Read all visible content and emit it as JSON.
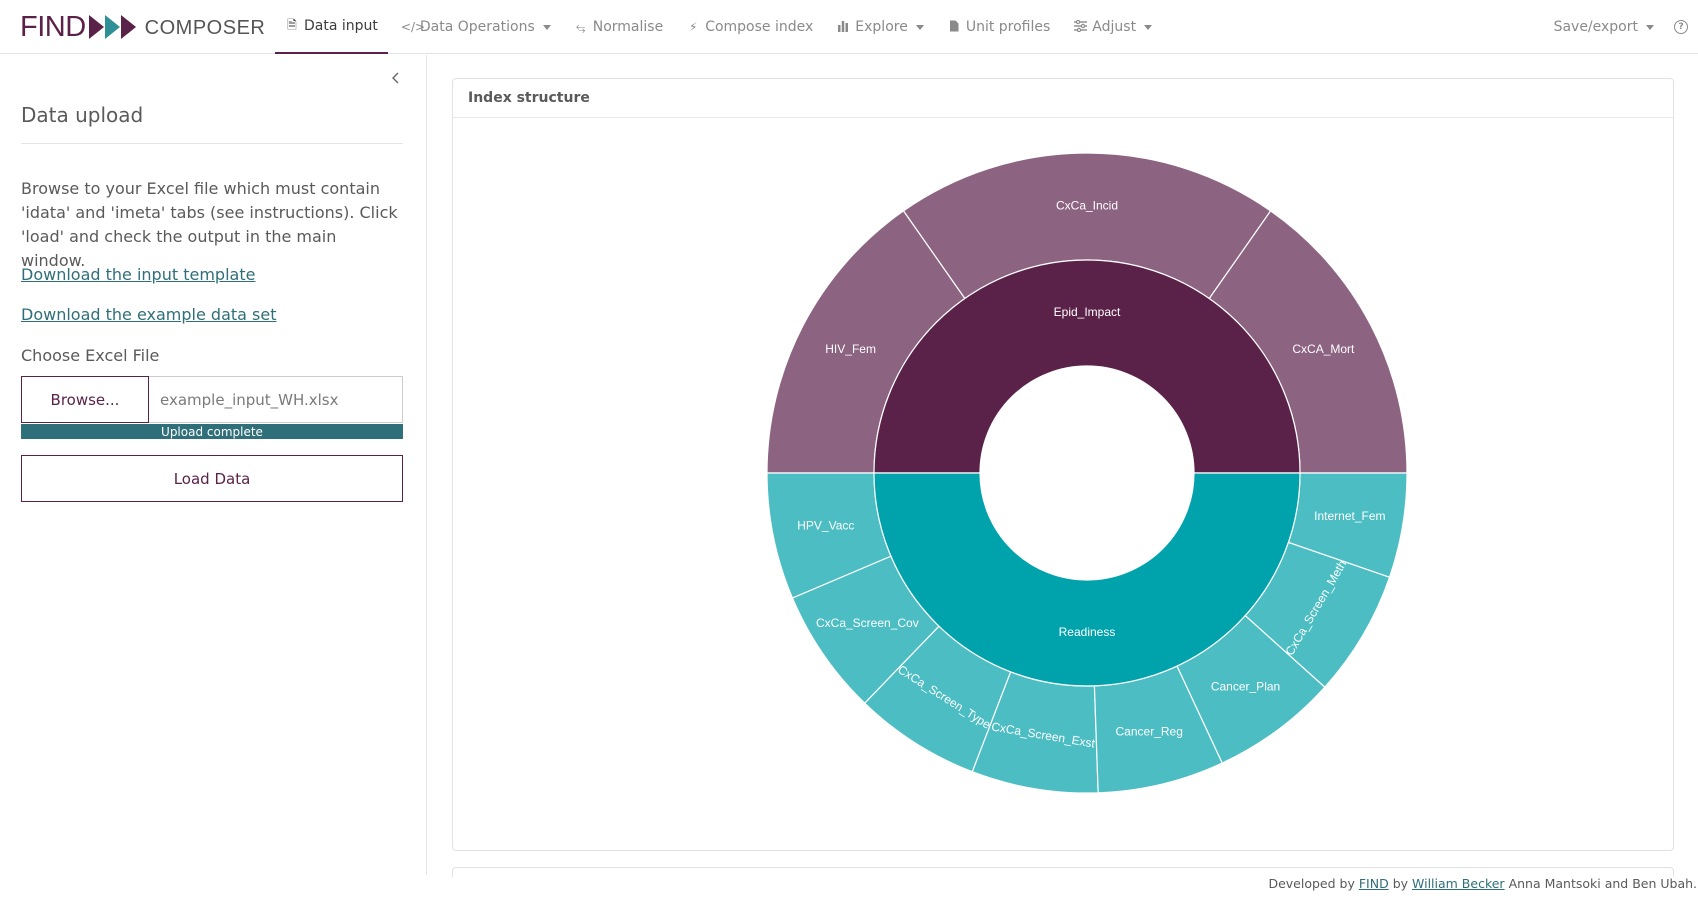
{
  "brand": {
    "find": "FIND",
    "composer": "COMPOSER"
  },
  "nav": {
    "items": [
      {
        "label": "Data input",
        "icon": "file-import-icon",
        "dropdown": false,
        "active": true
      },
      {
        "label": "Data Operations",
        "icon": "code-icon",
        "dropdown": true,
        "active": false
      },
      {
        "label": "Normalise",
        "icon": "compress-icon",
        "dropdown": false,
        "active": false
      },
      {
        "label": "Compose index",
        "icon": "bolt-icon",
        "dropdown": false,
        "active": false
      },
      {
        "label": "Explore",
        "icon": "bar-chart-icon",
        "dropdown": true,
        "active": false
      },
      {
        "label": "Unit profiles",
        "icon": "file-icon",
        "dropdown": false,
        "active": false
      },
      {
        "label": "Adjust",
        "icon": "sliders-icon",
        "dropdown": true,
        "active": false
      }
    ],
    "save_export": "Save/export",
    "help": "?"
  },
  "sidebar": {
    "title": "Data upload",
    "description": "Browse to your Excel file which must contain 'idata' and 'imeta' tabs (see instructions). Click 'load' and check the output in the main window.",
    "link_template": "Download the input template",
    "link_example": "Download the example data set",
    "file_label": "Choose Excel File",
    "browse_label": "Browse...",
    "file_name": "example_input_WH.xlsx",
    "progress_label": "Upload complete",
    "progress_fraction": 1.0,
    "load_label": "Load Data"
  },
  "main": {
    "card_title": "Index structure"
  },
  "chart_data": {
    "type": "sunburst",
    "colors": {
      "Epid_Impact": "#5b2249",
      "Epid_Impact_child": "#8c6380",
      "Readiness": "#00a2ac",
      "Readiness_child": "#4bbdc3"
    },
    "groups": [
      {
        "name": "Epid_Impact",
        "children": [
          "CxCA_Mort",
          "CxCa_Incid",
          "HIV_Fem"
        ]
      },
      {
        "name": "Readiness",
        "children": [
          "HPV_Vacc",
          "CxCa_Screen_Cov",
          "CxCa_Screen_Type",
          "CxCa_Screen_Exst",
          "Cancer_Reg",
          "Cancer_Plan",
          "CxCa_Screen_Meth",
          "Internet_Fem"
        ]
      }
    ]
  },
  "footer": {
    "prefix": "Developed by",
    "find_link": "FIND",
    "by": "by",
    "author_link": "William Becker",
    "rest": "Anna Mantsoki and Ben Ubah."
  }
}
